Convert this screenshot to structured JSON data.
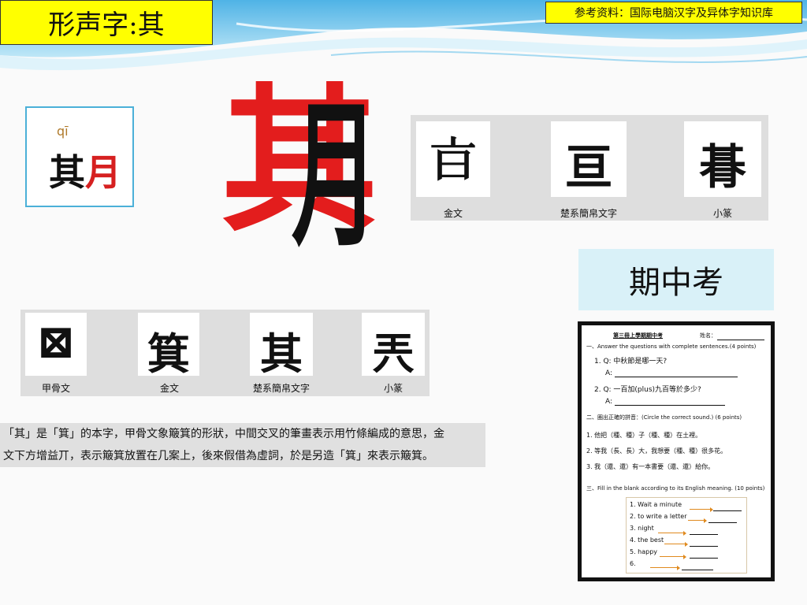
{
  "header": {
    "title": "形声字:其",
    "reference": "参考资料：国际电脑汉字及异体字知识库"
  },
  "pinyin_card": {
    "pinyin": "qī",
    "char_left": "其",
    "char_right": "月"
  },
  "big_char": {
    "phonetic_part": "其",
    "radical_part": "月"
  },
  "top_strip": {
    "items": [
      {
        "label": "金文",
        "glyph": "𣅀"
      },
      {
        "label": "楚系簡帛文字",
        "glyph": "亘"
      },
      {
        "label": "小篆",
        "glyph": "朞"
      }
    ]
  },
  "bottom_strip": {
    "items": [
      {
        "label": "甲骨文",
        "glyph": "⊠"
      },
      {
        "label": "金文",
        "glyph": "箕"
      },
      {
        "label": "楚系簡帛文字",
        "glyph": "其"
      },
      {
        "label": "小篆",
        "glyph": "兲"
      }
    ]
  },
  "exam_title": "期中考",
  "explanation": {
    "line1": "「其」是「箕」的本字，甲骨文象簸箕的形狀，中間交叉的筆畫表示用竹條編成的意思，金",
    "line2": "文下方增益丌，表示簸箕放置在几案上，後來假借為虛詞，於是另造「箕」來表示簸箕。"
  },
  "worksheet": {
    "heading": "第三冊上學期期中考",
    "name_label": "姓名：",
    "sec1": "一、Answer the questions with complete sentences.(4 points)",
    "q1": "1. Q: 中秋節是哪一天?",
    "a_label": "A:",
    "q2": "2. Q: 一百加(plus)九百等於多少?",
    "sec2": "二、圈出正確的拼音：(Circle the correct sound.) (6 points)",
    "s1": "1. 他把（種、種）子（種、種）在土裡。",
    "s2": "2. 等我（長、長）大，我想要（種、種）很多花。",
    "s3": "3. 我（還、還）有一本書要（還、還）給你。",
    "sec3": "三、Fill in the blank according to its English meaning. (10 points)",
    "fill_items": [
      "1. Wait a minute",
      "2. to write a letter",
      "3. night",
      "4. the best",
      "5. happy",
      "6."
    ]
  }
}
